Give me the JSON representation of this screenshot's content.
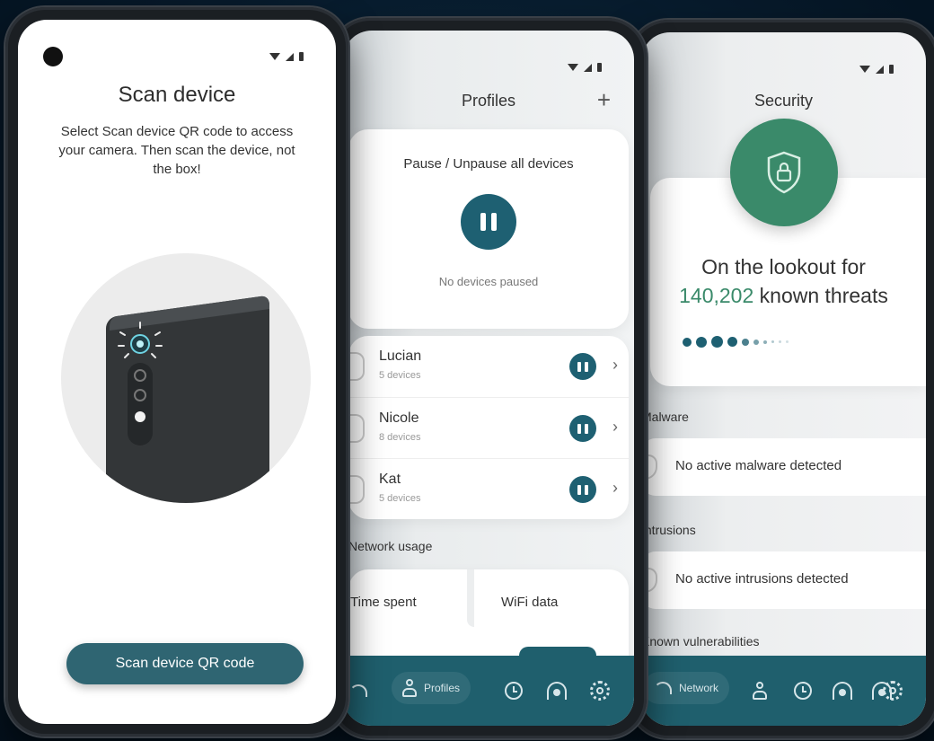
{
  "scan": {
    "title": "Scan device",
    "description": "Select Scan device QR code to access your camera. Then scan the device, not the box!",
    "button": "Scan device QR code"
  },
  "profiles": {
    "title": "Profiles",
    "pause_card_title": "Pause / Unpause all devices",
    "pause_status": "No devices paused",
    "items": [
      {
        "name": "Lucian",
        "devices": "5 devices"
      },
      {
        "name": "Nicole",
        "devices": "8 devices"
      },
      {
        "name": "Kat",
        "devices": "5 devices"
      }
    ],
    "network_usage_label": "Network usage",
    "tabs": [
      "Time spent",
      "WiFi data"
    ],
    "nav_active_label": "Profiles"
  },
  "security": {
    "title": "Security",
    "lookout_line1": "On the lookout for",
    "threat_count": "140,202",
    "threat_suffix": " known threats",
    "sections": [
      {
        "label": "Malware",
        "row": "No active malware detected"
      },
      {
        "label": "Intrusions",
        "row": "No active intrusions detected"
      }
    ],
    "known_vulnerabilities_label": "Known vulnerabilities",
    "nav_active_label": "Network"
  },
  "colors": {
    "accent_teal": "#1e6072",
    "nav_bg": "#1f5f6d",
    "shield_green": "#3a8a6a"
  },
  "icons": [
    "wifi-icon",
    "person-icon",
    "clock-icon",
    "headset-icon",
    "gear-icon",
    "plus-icon",
    "shield-lock-icon",
    "chevron-right-icon"
  ]
}
